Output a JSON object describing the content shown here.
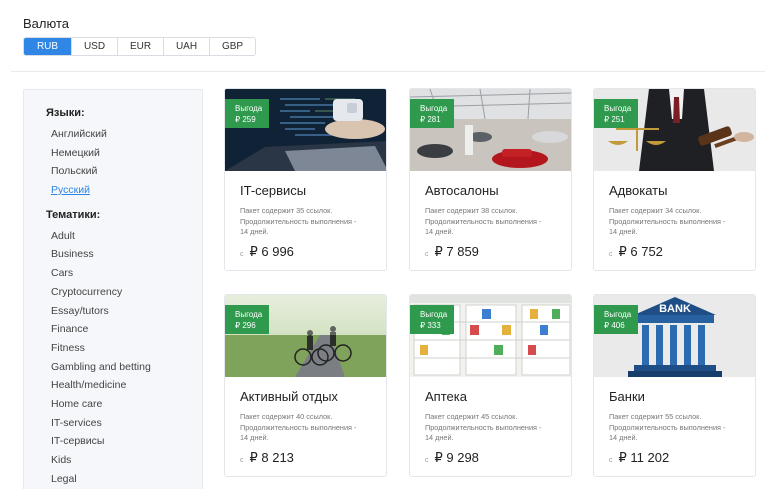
{
  "currency": {
    "title": "Валюта",
    "options": [
      "RUB",
      "USD",
      "EUR",
      "UAH",
      "GBP"
    ],
    "selected": "RUB"
  },
  "sidebar": {
    "languages_heading": "Языки:",
    "languages": [
      "Английский",
      "Немецкий",
      "Польский",
      "Русский"
    ],
    "selected_language": "Русский",
    "topics_heading": "Тематики:",
    "topics": [
      "Adult",
      "Business",
      "Cars",
      "Cryptocurrency",
      "Essay/tutors",
      "Finance",
      "Fitness",
      "Gambling and betting",
      "Health/medicine",
      "Home care",
      "IT-services",
      "IT-сервисы",
      "Kids",
      "Legal"
    ]
  },
  "cards": [
    {
      "badge_label": "Выгода",
      "badge_value": "₽ 259",
      "title": "IT-сервисы",
      "desc_line1": "Пакет содержит 35 ссылок.",
      "desc_line2": "Продолжительность выполнения -",
      "desc_line3": "14 дней.",
      "price_from": "с",
      "price": "₽ 6 996",
      "image": "laptop-code"
    },
    {
      "badge_label": "Выгода",
      "badge_value": "₽ 281",
      "title": "Автосалоны",
      "desc_line1": "Пакет содержит 38 ссылок.",
      "desc_line2": "Продолжительность выполнения -",
      "desc_line3": "14 дней.",
      "price_from": "с",
      "price": "₽ 7 859",
      "image": "car-showroom"
    },
    {
      "badge_label": "Выгода",
      "badge_value": "₽ 251",
      "title": "Адвокаты",
      "desc_line1": "Пакет содержит 34 ссылок.",
      "desc_line2": "Продолжительность выполнения -",
      "desc_line3": "14 дней.",
      "price_from": "с",
      "price": "₽ 6 752",
      "image": "scales-gavel"
    },
    {
      "badge_label": "Выгода",
      "badge_value": "₽ 296",
      "title": "Активный отдых",
      "desc_line1": "Пакет содержит 40 ссылок.",
      "desc_line2": "Продолжительность выполнения -",
      "desc_line3": "14 дней.",
      "price_from": "с",
      "price": "₽ 8 213",
      "image": "cyclists"
    },
    {
      "badge_label": "Выгода",
      "badge_value": "₽ 333",
      "title": "Аптека",
      "desc_line1": "Пакет содержит 45 ссылок.",
      "desc_line2": "Продолжительность выполнения -",
      "desc_line3": "14 дней.",
      "price_from": "с",
      "price": "₽ 9 298",
      "image": "pharmacy-shelves"
    },
    {
      "badge_label": "Выгода",
      "badge_value": "₽ 406",
      "title": "Банки",
      "desc_line1": "Пакет содержит 55 ссылок.",
      "desc_line2": "Продолжительность выполнения -",
      "desc_line3": "14 дней.",
      "price_from": "с",
      "price": "₽ 11 202",
      "image": "bank-building",
      "image_text": "BANK"
    }
  ],
  "colors": {
    "accent": "#2f86e5",
    "badge": "#2f9a4d"
  }
}
